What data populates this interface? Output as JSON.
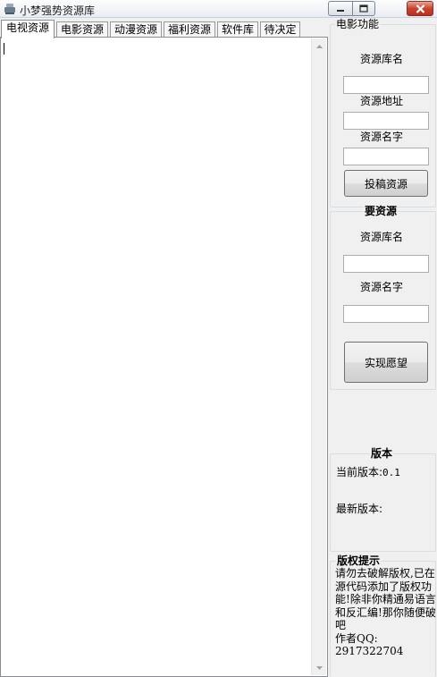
{
  "window": {
    "title": "小梦强势资源库",
    "icon": "app-icon"
  },
  "tabs": [
    {
      "label": "电视资源",
      "active": true
    },
    {
      "label": "电影资源",
      "active": false
    },
    {
      "label": "动漫资源",
      "active": false
    },
    {
      "label": "福利资源",
      "active": false
    },
    {
      "label": "软件库",
      "active": false
    },
    {
      "label": "待决定",
      "active": false
    }
  ],
  "editor": {
    "value": ""
  },
  "movie_panel": {
    "legend": "电影功能",
    "repo_name_label": "资源库名",
    "repo_name_value": "",
    "address_label": "资源地址",
    "address_value": "",
    "resource_name_label": "资源名字",
    "resource_name_value": "",
    "submit_label": "投稿资源"
  },
  "wish_panel": {
    "legend": "要资源",
    "repo_name_label": "资源库名",
    "repo_name_value": "",
    "resource_name_label": "资源名字",
    "resource_name_value": "",
    "submit_label": "实现愿望"
  },
  "version_panel": {
    "legend": "版本",
    "current_label": "当前版本:",
    "current_value": "0.1",
    "latest_label": "最新版本:",
    "latest_value": ""
  },
  "copyright_panel": {
    "legend": "版权提示",
    "text": "请勿去破解版权,已在源代码添加了版权功能!除非你精通易语言和反汇编!那你随便破吧",
    "author_label": "作者QQ:",
    "author_qq": "2917322704"
  },
  "colors": {
    "close_button": "#c9442e",
    "panel_bg": "#f0f0f0",
    "group_border": "#d5dfe5"
  }
}
